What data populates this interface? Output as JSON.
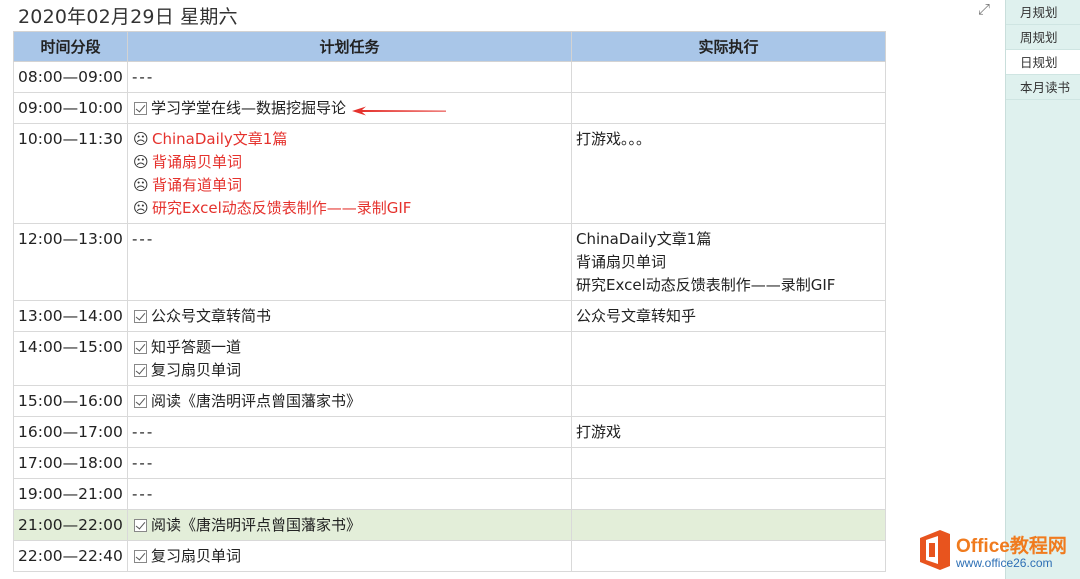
{
  "page": {
    "title": "2020年02月29日 星期六"
  },
  "table": {
    "headers": [
      "时间分段",
      "计划任务",
      "实际执行"
    ],
    "rows": [
      {
        "time": "08:00—09:00",
        "tasks": [
          {
            "mark": "none",
            "text": "---"
          }
        ],
        "actual": []
      },
      {
        "time": "09:00—10:00",
        "tasks": [
          {
            "mark": "check",
            "text": "学习学堂在线—数据挖掘导论"
          }
        ],
        "actual": []
      },
      {
        "time": "10:00—11:30",
        "tasks": [
          {
            "mark": "frown",
            "text": "ChinaDaily文章1篇",
            "color": "#e5322d"
          },
          {
            "mark": "frown",
            "text": "背诵扇贝单词",
            "color": "#e5322d"
          },
          {
            "mark": "frown",
            "text": "背诵有道单词",
            "color": "#e5322d"
          },
          {
            "mark": "frown",
            "text": "研究Excel动态反馈表制作——录制GIF",
            "color": "#e5322d"
          }
        ],
        "actual": [
          "打游戏。。。"
        ]
      },
      {
        "time": "12:00—13:00",
        "tasks": [
          {
            "mark": "none",
            "text": "---"
          }
        ],
        "actual": [
          "ChinaDaily文章1篇",
          "背诵扇贝单词",
          "研究Excel动态反馈表制作——录制GIF"
        ]
      },
      {
        "time": "13:00—14:00",
        "tasks": [
          {
            "mark": "check",
            "text": "公众号文章转简书"
          }
        ],
        "actual": [
          "公众号文章转知乎"
        ]
      },
      {
        "time": "14:00—15:00",
        "tasks": [
          {
            "mark": "check",
            "text": "知乎答题一道"
          },
          {
            "mark": "check",
            "text": "复习扇贝单词"
          }
        ],
        "actual": []
      },
      {
        "time": "15:00—16:00",
        "tasks": [
          {
            "mark": "check",
            "text": "阅读《唐浩明评点曾国藩家书》"
          }
        ],
        "actual": []
      },
      {
        "time": "16:00—17:00",
        "tasks": [
          {
            "mark": "none",
            "text": "---"
          }
        ],
        "actual": [
          "打游戏"
        ]
      },
      {
        "time": "17:00—18:00",
        "tasks": [
          {
            "mark": "none",
            "text": "---"
          }
        ],
        "actual": []
      },
      {
        "time": "19:00—21:00",
        "tasks": [
          {
            "mark": "none",
            "text": "---"
          }
        ],
        "actual": []
      },
      {
        "time": "21:00—22:00",
        "tasks": [
          {
            "mark": "check",
            "text": "阅读《唐浩明评点曾国藩家书》"
          }
        ],
        "actual": [],
        "highlight": true
      },
      {
        "time": "22:00—22:40",
        "tasks": [
          {
            "mark": "check",
            "text": "复习扇贝单词"
          }
        ],
        "actual": []
      }
    ]
  },
  "sidebar": {
    "expand_icon": "expand-icon",
    "pages": [
      {
        "label": "月规划",
        "active": false
      },
      {
        "label": "周规划",
        "active": false
      },
      {
        "label": "日规划",
        "active": true
      },
      {
        "label": "本月读书",
        "active": false
      }
    ]
  },
  "watermark": {
    "brand": "Office教程网",
    "url": "www.office26.com"
  },
  "colors": {
    "header_bg": "#a9c6e8",
    "highlight_row": "#e3eed9",
    "incomplete_text": "#e5322d",
    "pages_panel": "#dff1ee",
    "arrow": "#e5322d"
  }
}
